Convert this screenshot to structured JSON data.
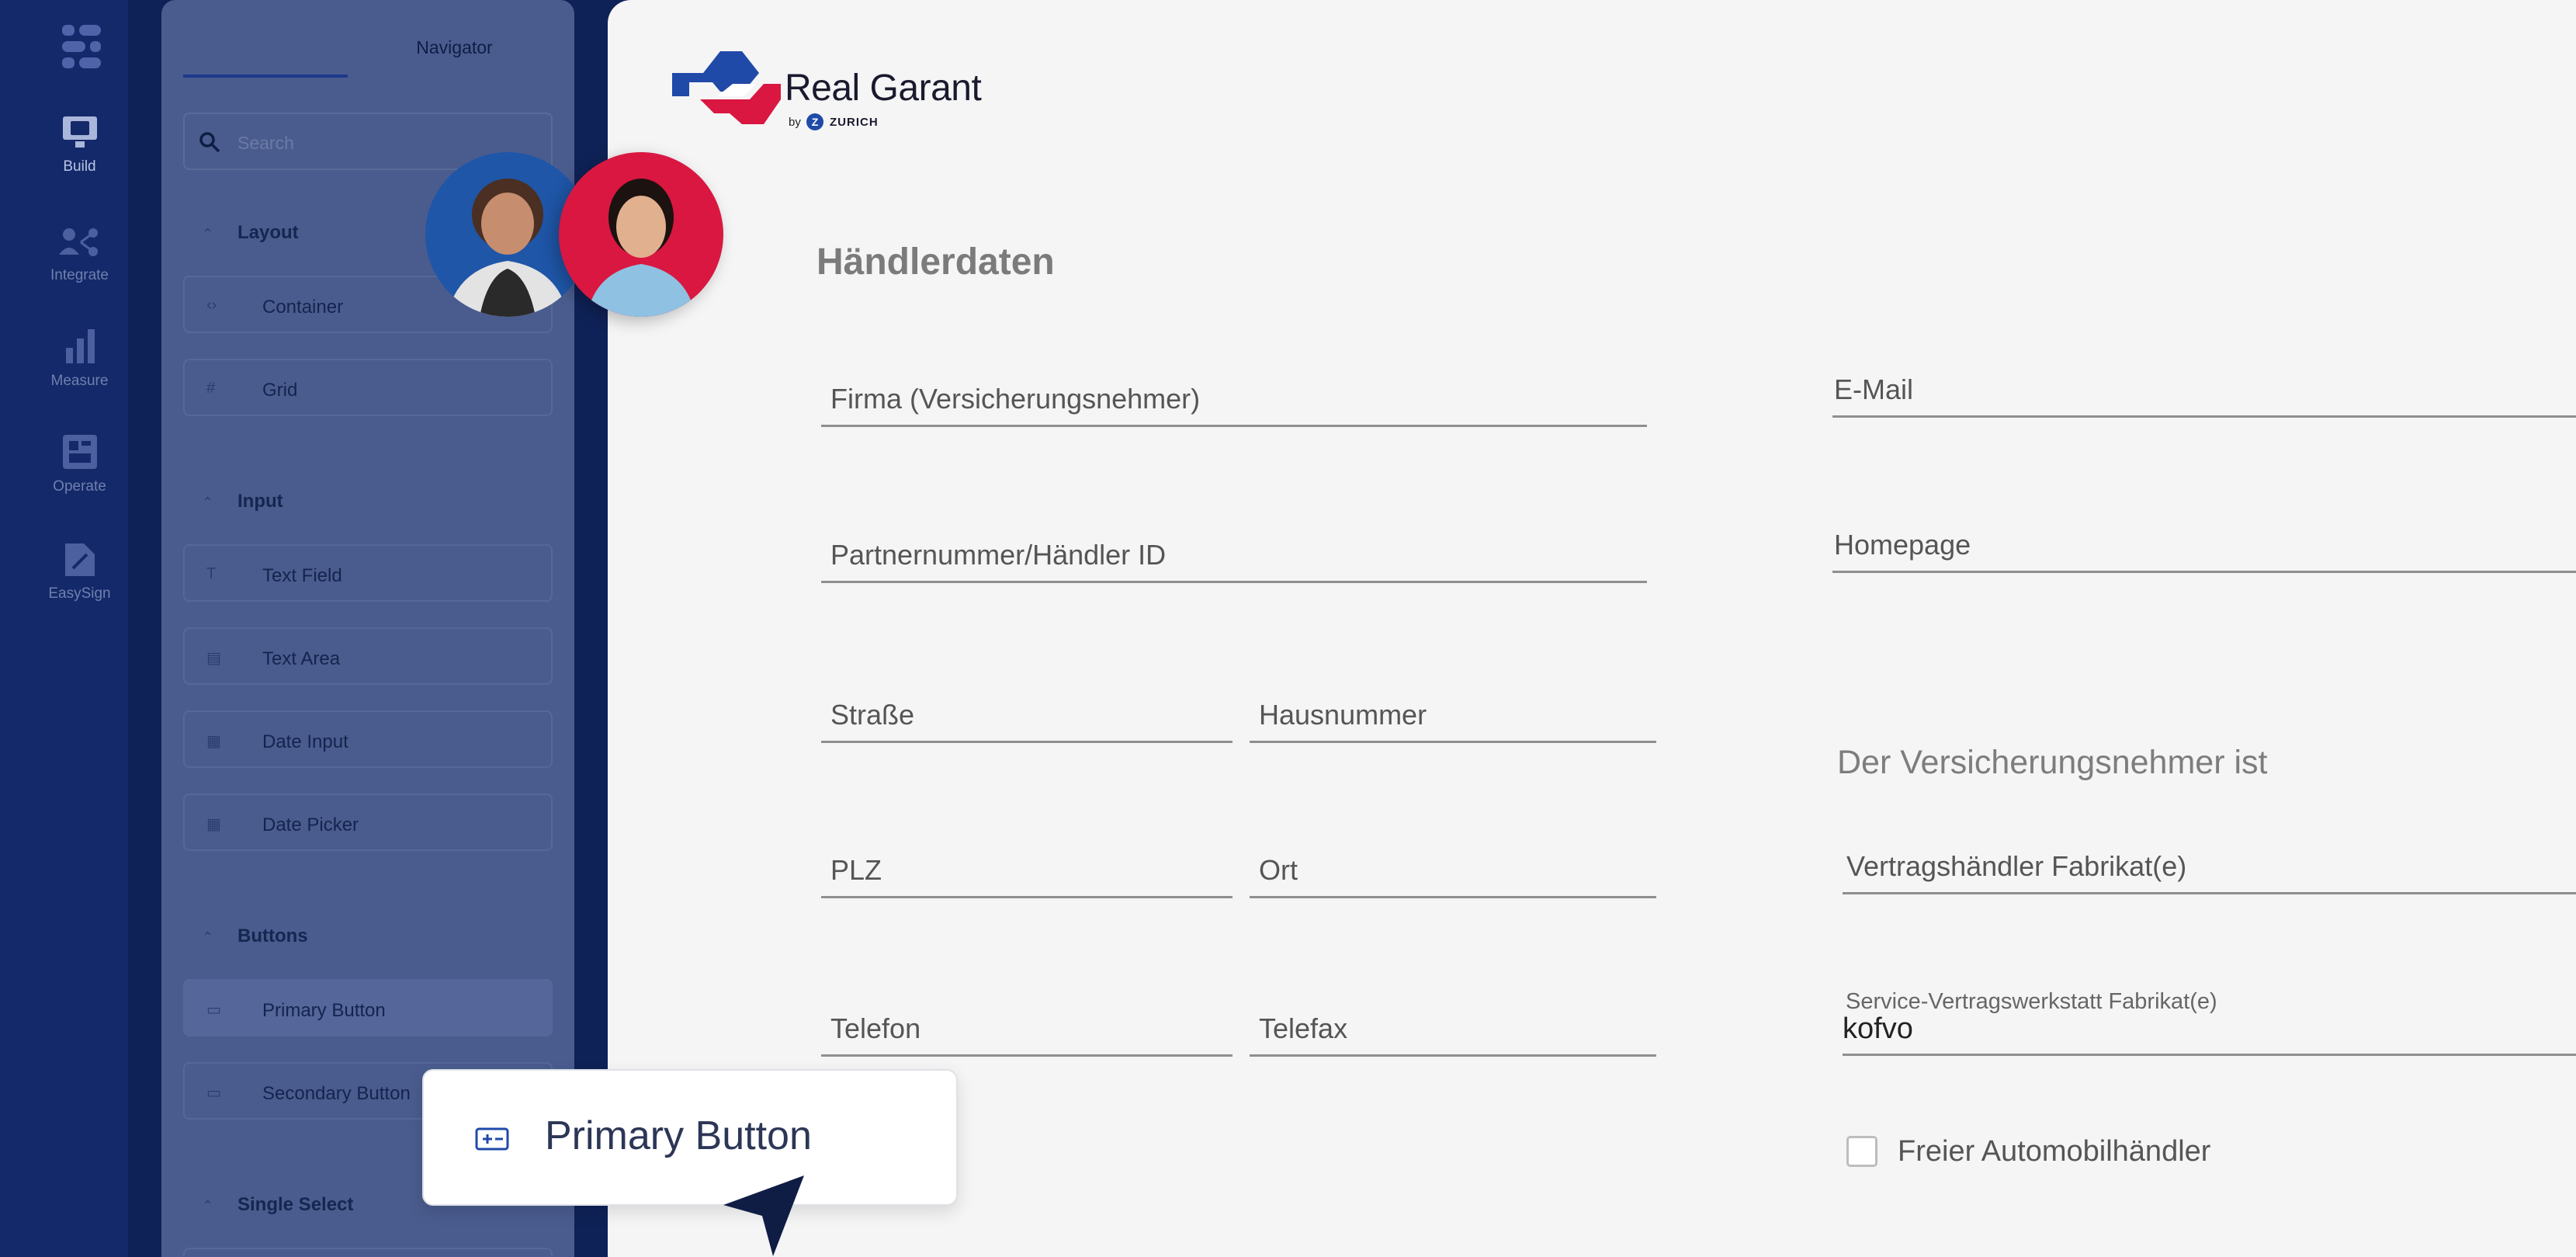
{
  "rail": {
    "items": [
      {
        "label": "Build",
        "icon": "build-icon",
        "active": true
      },
      {
        "label": "Integrate",
        "icon": "integrate-icon",
        "active": false
      },
      {
        "label": "Measure",
        "icon": "measure-icon",
        "active": false
      },
      {
        "label": "Operate",
        "icon": "operate-icon",
        "active": false
      },
      {
        "label": "EasySign",
        "icon": "easysign-icon",
        "active": false
      }
    ]
  },
  "navigator": {
    "tab_title": "Navigator",
    "search_placeholder": "Search",
    "sections": {
      "layout": "Layout",
      "input": "Input",
      "buttons": "Buttons",
      "single_select": "Single Select"
    },
    "items": {
      "container": "Container",
      "grid": "Grid",
      "text_field": "Text Field",
      "text_area": "Text Area",
      "date_input": "Date Input",
      "date_picker": "Date Picker",
      "primary_button": "Primary Button",
      "secondary_button": "Secondary Button"
    }
  },
  "brand": {
    "name": "Real Garant",
    "by": "by",
    "partner": "ZURICH",
    "partner_mark": "Z"
  },
  "form": {
    "title": "Händlerdaten",
    "fields": {
      "firma": "Firma (Versicherungsnehmer)",
      "email": "E-Mail",
      "partner": "Partnernummer/Händler ID",
      "homepage": "Homepage",
      "strasse": "Straße",
      "hausnummer": "Hausnummer",
      "plz": "PLZ",
      "ort": "Ort",
      "telefon": "Telefon",
      "telefax": "Telefax",
      "vertragshaendler": "Vertragshändler Fabrikat(e)",
      "service_label": "Service-Vertragswerkstatt Fabrikat(e)",
      "service_value": "kofvo"
    },
    "section_heading": "Der Versicherungsnehmer ist",
    "checkbox_label": "Freier Automobilhändler",
    "checkbox_checked": false
  },
  "drag_preview": {
    "label": "Primary Button"
  },
  "colors": {
    "rail": "#14296a",
    "panel": "#4a5c8e",
    "brand_blue": "#1f4aa8",
    "brand_red": "#d91740"
  }
}
